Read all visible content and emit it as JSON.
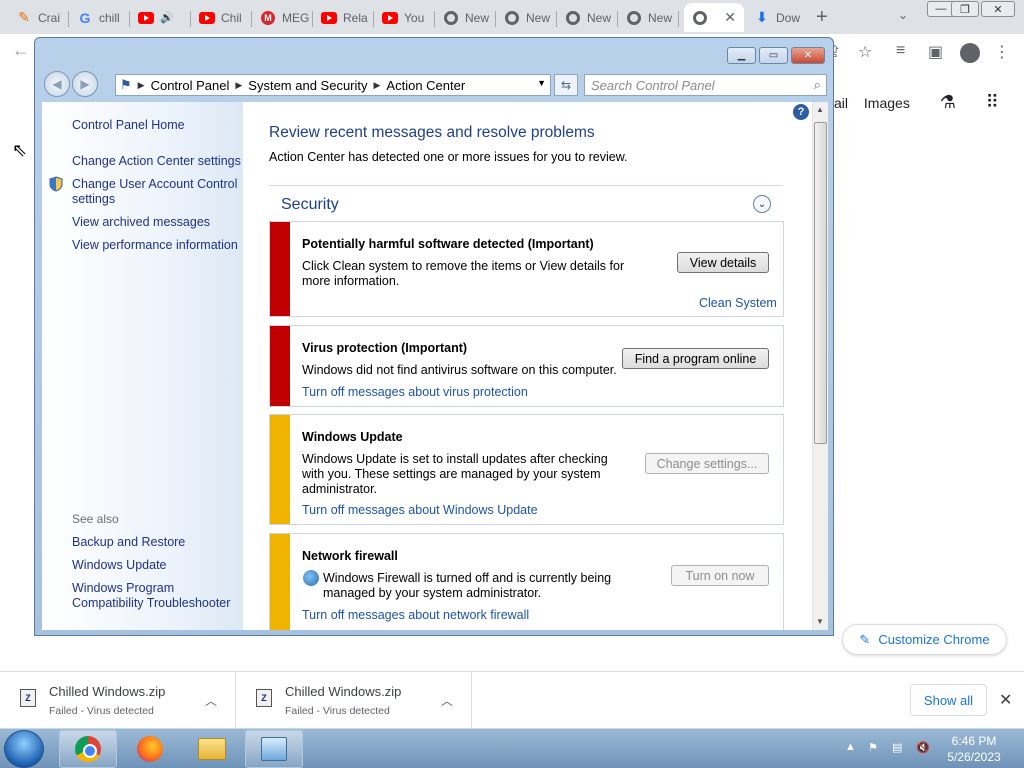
{
  "chrome": {
    "tabs": [
      {
        "label": "Crai",
        "icon": "pencil-icon"
      },
      {
        "label": "chill",
        "icon": "google-icon"
      },
      {
        "label": "",
        "icon": "youtube-icon",
        "audio": true
      },
      {
        "label": "Chil",
        "icon": "youtube-icon"
      },
      {
        "label": "MEG",
        "icon": "mega-icon"
      },
      {
        "label": "Rela",
        "icon": "youtube-icon"
      },
      {
        "label": "You",
        "icon": "youtube-icon"
      },
      {
        "label": "New",
        "icon": "chrome-icon"
      },
      {
        "label": "New",
        "icon": "chrome-icon"
      },
      {
        "label": "New",
        "icon": "chrome-icon"
      },
      {
        "label": "New",
        "icon": "chrome-icon"
      },
      {
        "label": "",
        "icon": "chrome-icon",
        "active": true
      },
      {
        "label": "Dow",
        "icon": "download-icon"
      }
    ],
    "page_links": {
      "mail": "ail",
      "images": "Images"
    },
    "customize_label": "Customize Chrome"
  },
  "control_panel": {
    "breadcrumb": [
      "Control Panel",
      "System and Security",
      "Action Center"
    ],
    "search_placeholder": "Search Control Panel",
    "left_links": [
      "Control Panel Home",
      "Change Action Center settings",
      "Change User Account Control settings",
      "View archived messages",
      "View performance information"
    ],
    "see_also_title": "See also",
    "see_also_links": [
      "Backup and Restore",
      "Windows Update",
      "Windows Program Compatibility Troubleshooter"
    ],
    "heading": "Review recent messages and resolve problems",
    "subheading": "Action Center has detected one or more issues for you to review.",
    "section_title": "Security",
    "messages": [
      {
        "severity_color": "#c00000",
        "title": "Potentially harmful software detected  (Important)",
        "text": "Click Clean system to remove the items or View details for more information.",
        "button": "View details",
        "link": "Clean System"
      },
      {
        "severity_color": "#c00000",
        "title": "Virus protection  (Important)",
        "text": "Windows did not find antivirus software on this computer.",
        "button": "Find a program online",
        "link": "Turn off messages about virus protection"
      },
      {
        "severity_color": "#f0b400",
        "title": "Windows Update",
        "text": "Windows Update is set to install updates after checking with you.  These settings are managed by your system administrator.",
        "button": "Change settings...",
        "link": "Turn off messages about Windows Update"
      },
      {
        "severity_color": "#f0b400",
        "title": "Network firewall",
        "text": "Windows Firewall is turned off and is currently being managed by your system administrator.",
        "button": "Turn on now",
        "link": "Turn off messages about network firewall"
      }
    ]
  },
  "downloads": {
    "items": [
      {
        "name": "Chilled Windows.zip",
        "status": "Failed - Virus detected"
      },
      {
        "name": "Chilled Windows.zip",
        "status": "Failed - Virus detected"
      }
    ],
    "show_all": "Show all"
  },
  "taskbar": {
    "time": "6:46 PM",
    "date": "5/26/2023"
  }
}
